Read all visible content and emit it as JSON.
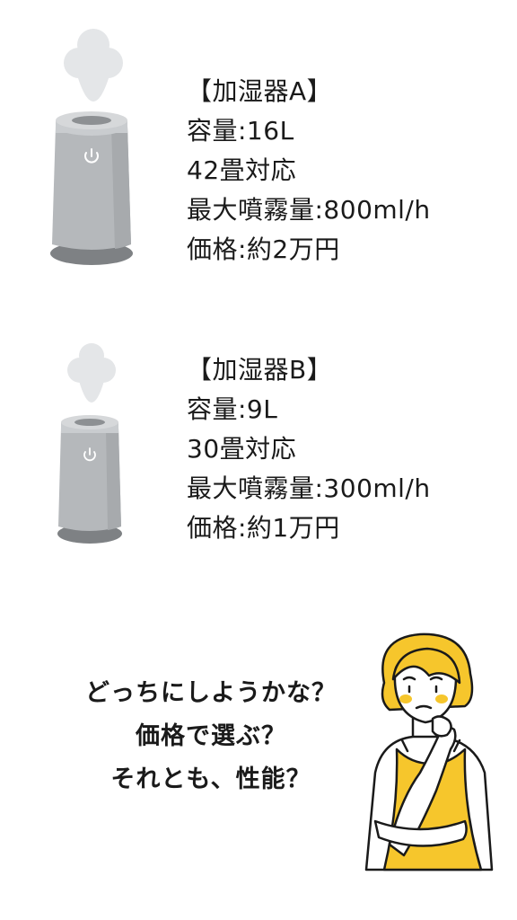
{
  "products": [
    {
      "name": "【加湿器A】",
      "capacity": "容量:16L",
      "room_size": "42畳対応",
      "max_mist": "最大噴霧量:800ml/h",
      "price": "価格:約2万円"
    },
    {
      "name": "【加湿器B】",
      "capacity": "容量:9L",
      "room_size": "30畳対応",
      "max_mist": "最大噴霧量:300ml/h",
      "price": "価格:約1万円"
    }
  ],
  "question": {
    "line1": "どっちにしようかな？",
    "line2": "価格で選ぶ？",
    "line3": "それとも、性能？"
  },
  "icons": {
    "humidifier": "humidifier-icon",
    "steam": "steam-icon",
    "power": "power-icon",
    "person": "thinking-woman-illustration"
  },
  "colors": {
    "humidifier_body": "#b5b8bb",
    "humidifier_top": "#c9cccf",
    "humidifier_base": "#7e8184",
    "steam": "#e4e6e8",
    "hair": "#f6c62c",
    "apron": "#f6c62c",
    "text": "#1a1a1a"
  }
}
